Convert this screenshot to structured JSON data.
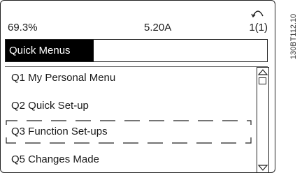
{
  "status": {
    "percent": "69.3%",
    "current": "5.20A",
    "setup": "1(1)",
    "back_icon": "back-arrow-icon"
  },
  "header": {
    "title": "Quick Menus"
  },
  "menu": {
    "items": [
      {
        "id": "q1",
        "label": "Q1 My Personal Menu",
        "focused": false
      },
      {
        "id": "q2",
        "label": "Q2 Quick Set-up",
        "focused": false
      },
      {
        "id": "q3",
        "label": "Q3 Function Set-ups",
        "focused": true
      },
      {
        "id": "q5",
        "label": "Q5 Changes Made",
        "focused": false
      }
    ]
  },
  "scrollbar": {
    "up_icon": "scroll-up-arrow-icon",
    "down_icon": "scroll-down-arrow-icon"
  },
  "figure_id": "130BT112.10"
}
